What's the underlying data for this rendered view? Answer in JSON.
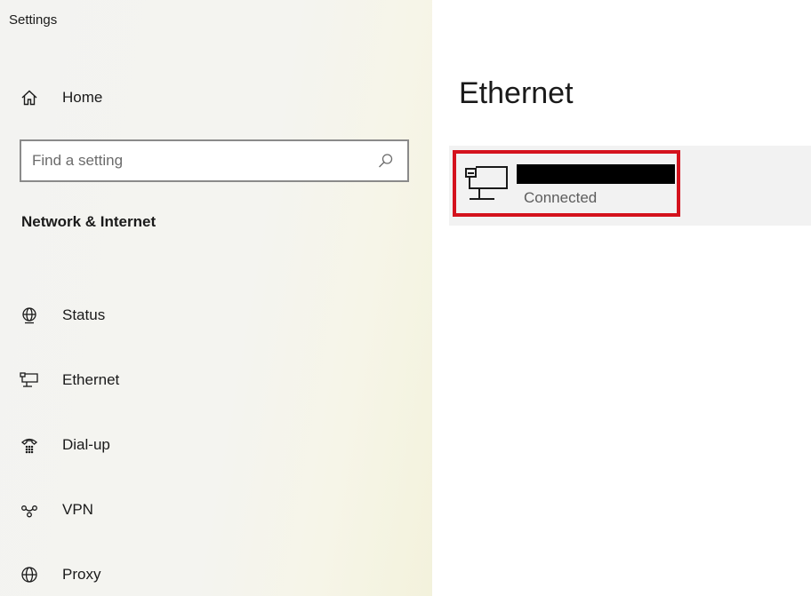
{
  "app": {
    "title": "Settings"
  },
  "sidebar": {
    "home_label": "Home",
    "home_icon": "home-icon",
    "search": {
      "placeholder": "Find a setting",
      "value": "",
      "icon": "search-icon"
    },
    "section_title": "Network & Internet",
    "items": [
      {
        "label": "Status",
        "icon": "globe-status-icon"
      },
      {
        "label": "Ethernet",
        "icon": "ethernet-icon"
      },
      {
        "label": "Dial-up",
        "icon": "dialup-phone-icon"
      },
      {
        "label": "VPN",
        "icon": "vpn-icon"
      },
      {
        "label": "Proxy",
        "icon": "globe-icon"
      }
    ]
  },
  "content": {
    "title": "Ethernet",
    "network": {
      "icon": "ethernet-icon",
      "status": "Connected"
    }
  },
  "colors": {
    "highlight": "#d4121d",
    "card_background": "#f2f2f2",
    "status_text": "#5d5d5d"
  }
}
